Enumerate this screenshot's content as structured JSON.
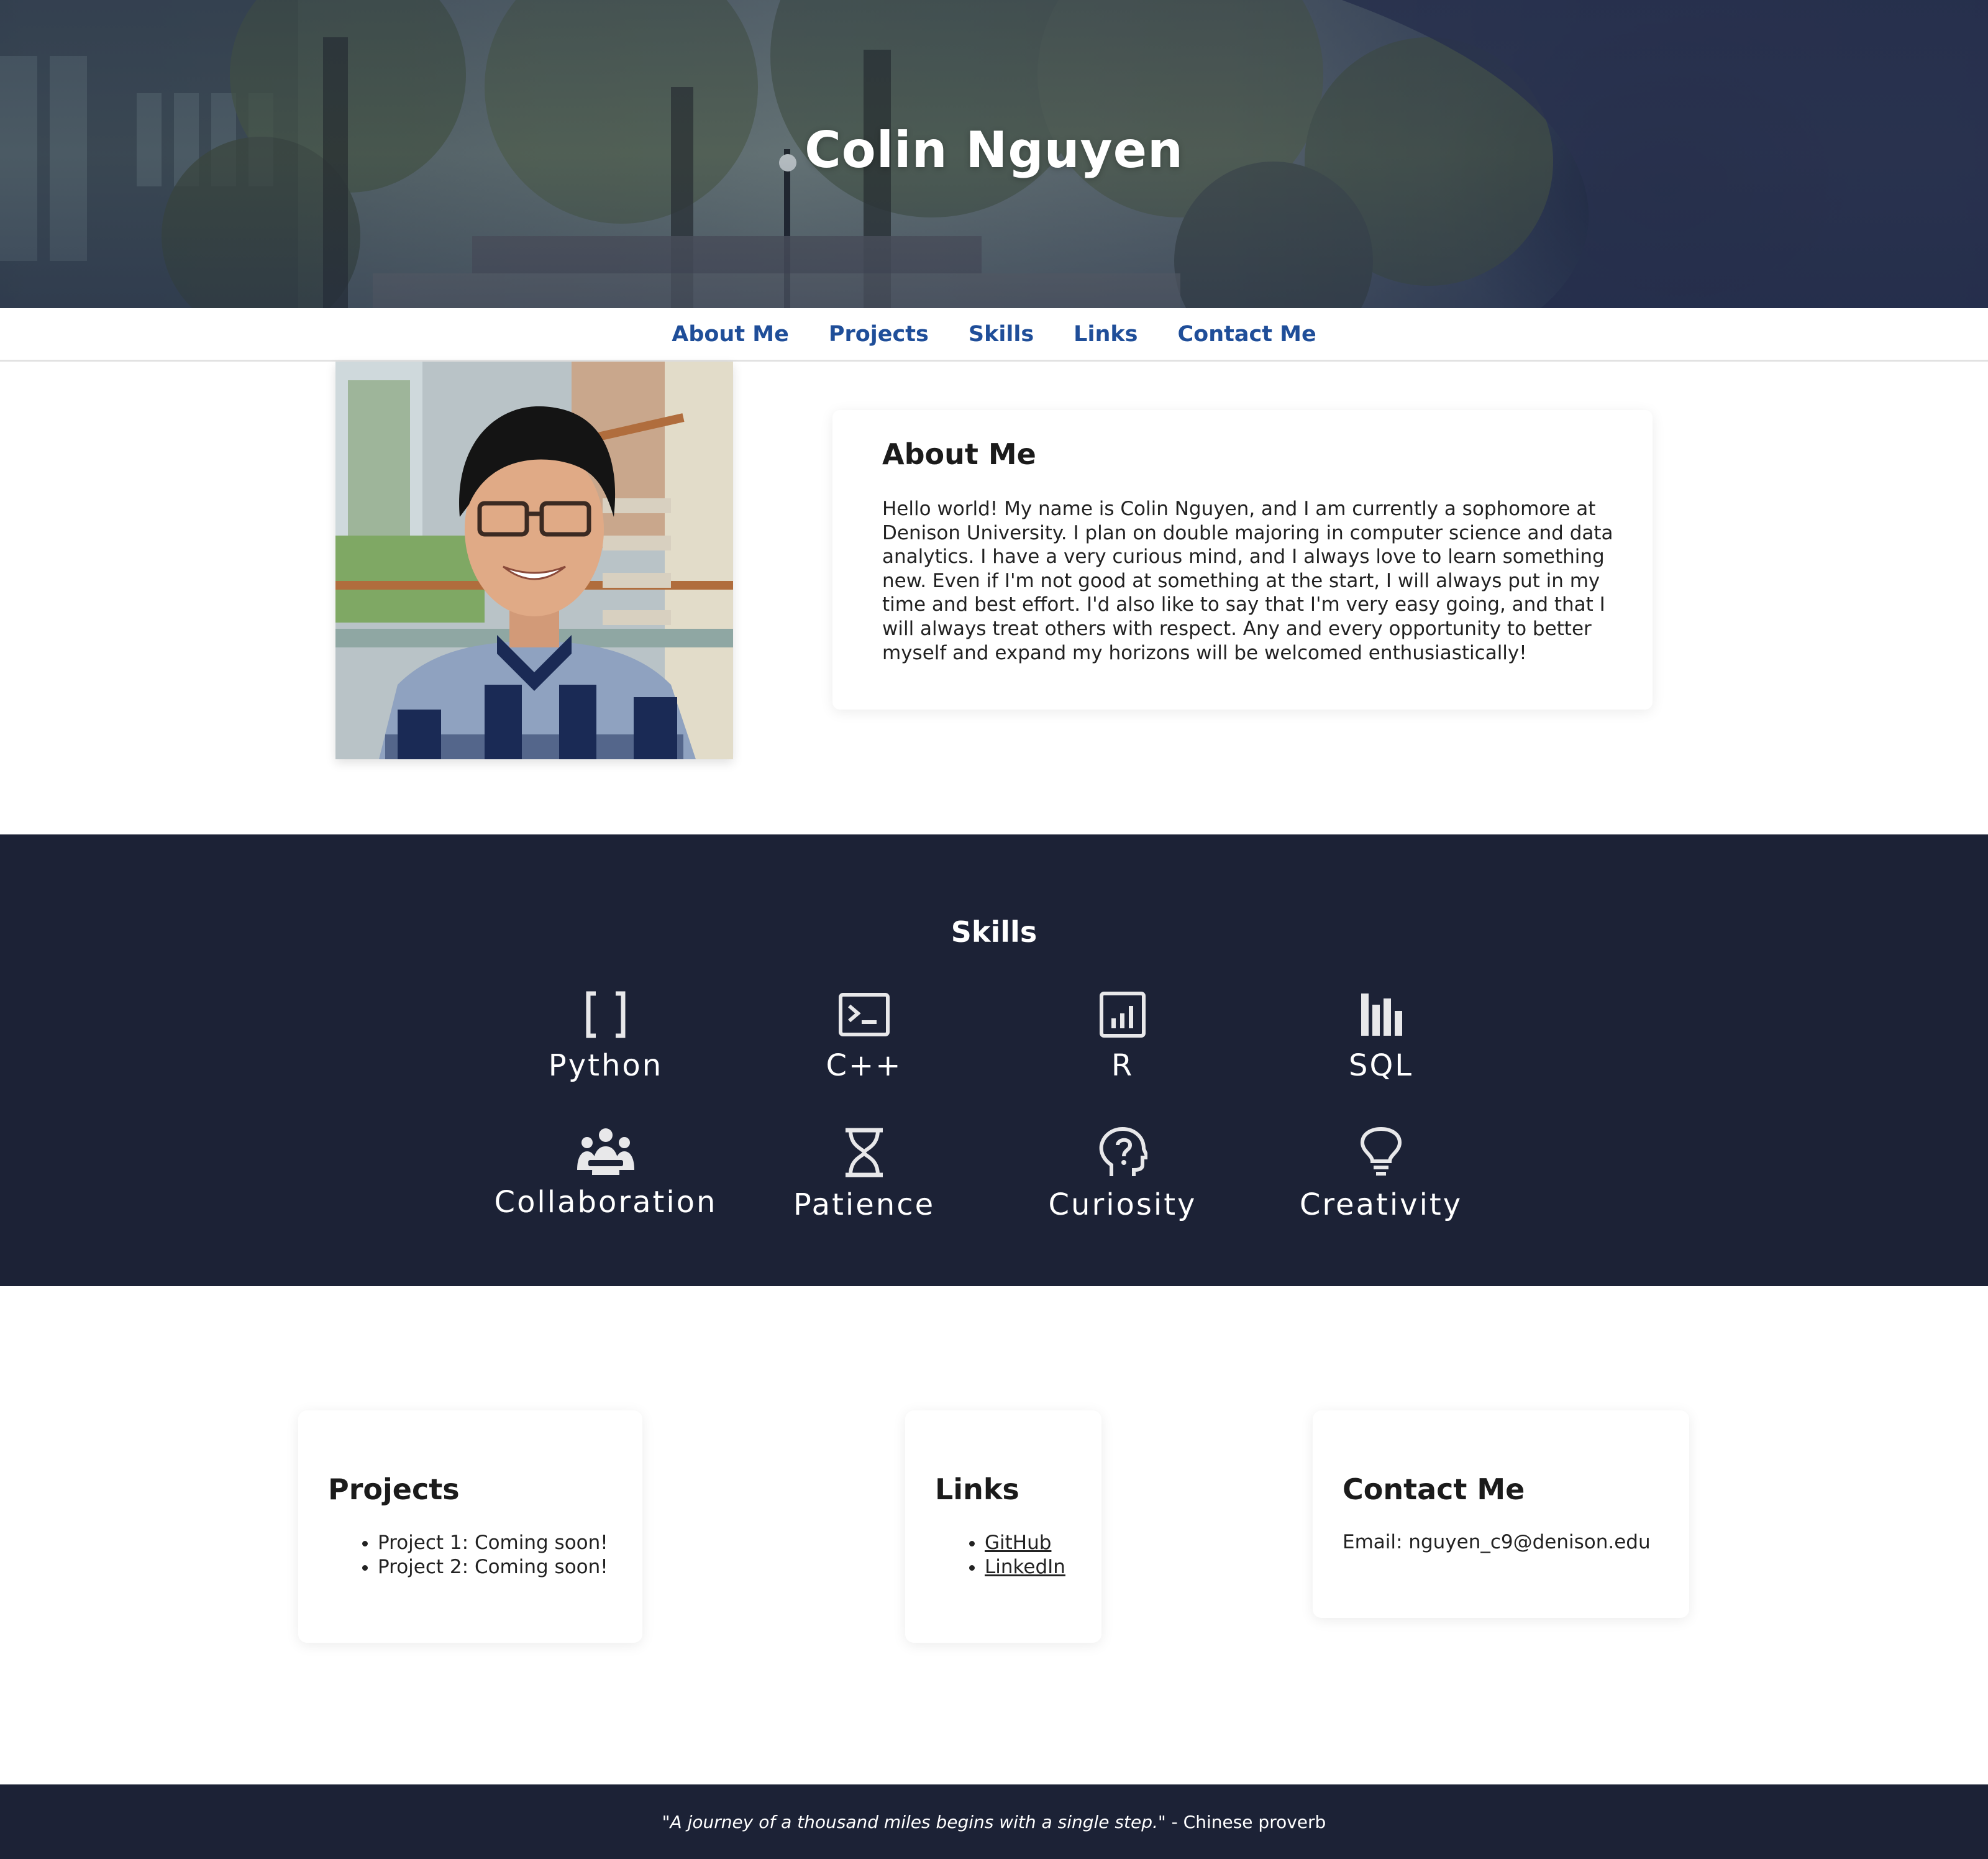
{
  "hero": {
    "title": "Colin Nguyen"
  },
  "nav": {
    "items": [
      "About Me",
      "Projects",
      "Skills",
      "Links",
      "Contact Me"
    ]
  },
  "about": {
    "heading": "About Me",
    "text": "Hello world! My name is Colin Nguyen, and I am currently a sophomore at Denison University. I plan on double majoring in computer science and data analytics. I have a very curious mind, and I always love to learn something new. Even if I'm not good at something at the start, I will always put in my time and best effort. I'd also like to say that I'm very easy going, and that I will always treat others with respect. Any and every opportunity to better myself and expand my horizons will be welcomed enthusiastically!"
  },
  "skills": {
    "heading": "Skills",
    "items": [
      {
        "label": "Python",
        "icon": "brackets-icon"
      },
      {
        "label": "C++",
        "icon": "terminal-icon"
      },
      {
        "label": "R",
        "icon": "bar-chart-icon"
      },
      {
        "label": "SQL",
        "icon": "columns-chart-icon"
      },
      {
        "label": "Collaboration",
        "icon": "group-icon"
      },
      {
        "label": "Patience",
        "icon": "hourglass-icon"
      },
      {
        "label": "Curiosity",
        "icon": "question-head-icon"
      },
      {
        "label": "Creativity",
        "icon": "lightbulb-icon"
      }
    ]
  },
  "projects": {
    "heading": "Projects",
    "items": [
      "Project 1: Coming soon!",
      "Project 2: Coming soon!"
    ]
  },
  "links": {
    "heading": "Links",
    "items": [
      "GitHub",
      "LinkedIn"
    ]
  },
  "contact": {
    "heading": "Contact Me",
    "email": "Email: nguyen_c9@denison.edu"
  },
  "footer": {
    "quote": "\"A journey of a thousand miles begins with a single step.\"",
    "attribution": " - Chinese proverb"
  },
  "colors": {
    "nav_link": "#1f4e99",
    "dark_band": "#1c2236"
  }
}
